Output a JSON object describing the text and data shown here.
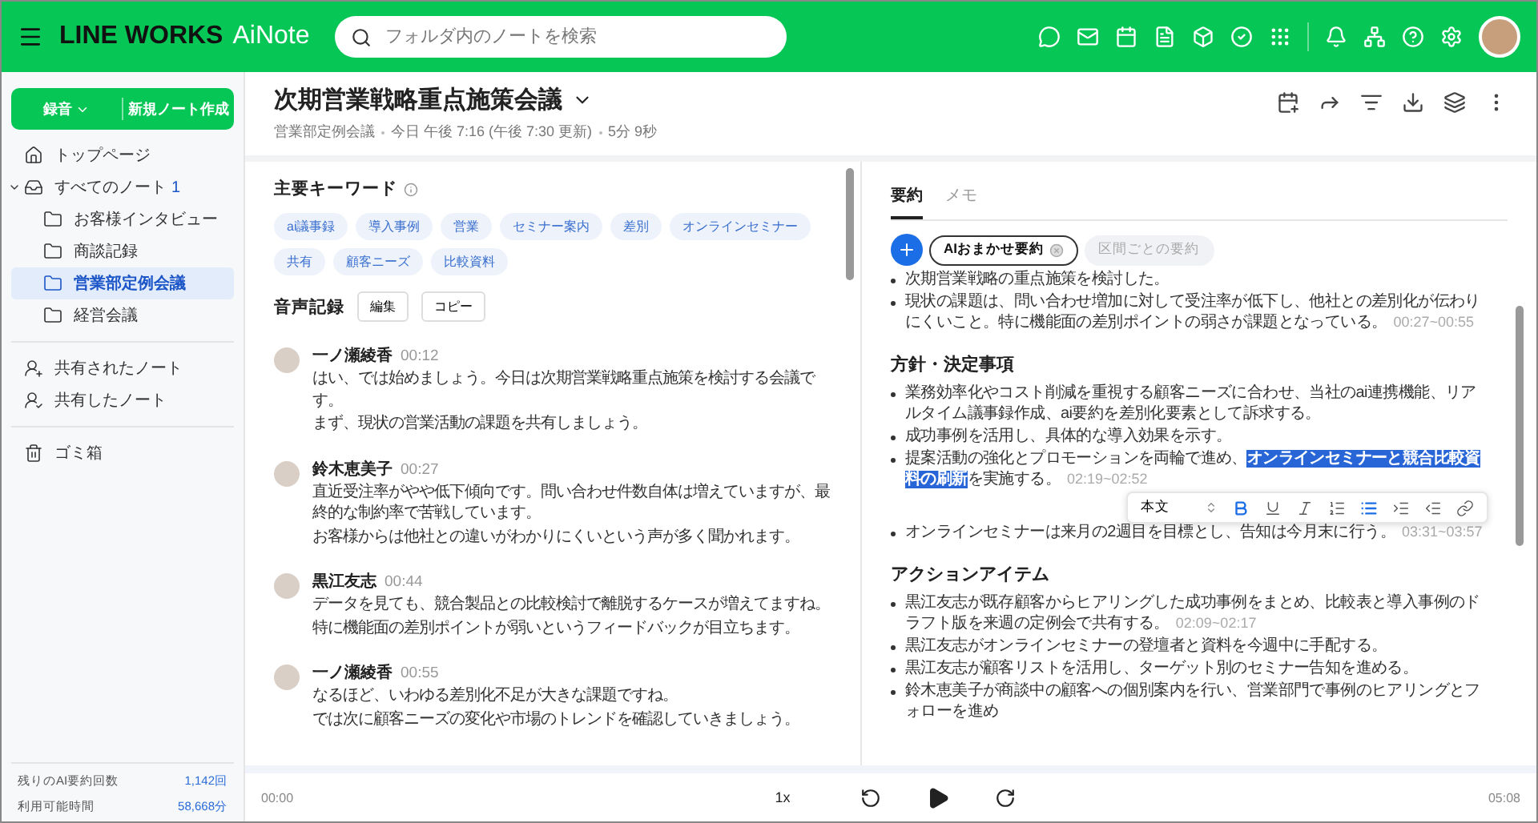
{
  "header": {
    "brand": "LINE WORKS",
    "product": "AiNote",
    "search": {
      "placeholder": "フォルダ内のノートを検索"
    }
  },
  "sidebar": {
    "record_button": "録音",
    "new_note_button": "新規ノート作成",
    "items": [
      {
        "kind": "home",
        "label": "トップページ",
        "selected": false
      },
      {
        "kind": "inbox",
        "label": "すべてのノート",
        "count": "1",
        "selected": false,
        "expanded": true,
        "children": [
          {
            "kind": "folder",
            "label": "お客様インタビュー",
            "selected": false
          },
          {
            "kind": "folder",
            "label": "商談記録",
            "selected": false
          },
          {
            "kind": "folder",
            "label": "営業部定例会議",
            "selected": true
          },
          {
            "kind": "folder",
            "label": "経営会議",
            "selected": false
          }
        ]
      },
      {
        "kind": "shared-with",
        "label": "共有されたノート",
        "selected": false
      },
      {
        "kind": "shared-by",
        "label": "共有したノート",
        "selected": false
      },
      {
        "kind": "trash",
        "label": "ゴミ箱",
        "selected": false
      }
    ],
    "stats": [
      {
        "label": "残りのAI要約回数",
        "value": "1,142回"
      },
      {
        "label": "利用可能時間",
        "value": "58,668分"
      }
    ]
  },
  "note": {
    "title": "次期営業戦略重点施策会議",
    "meta": [
      "営業部定例会議",
      "今日 午後 7:16 (午後 7:30 更新)",
      "5分 9秒"
    ]
  },
  "keywords": {
    "title": "主要キーワード",
    "tags": [
      "ai議事録",
      "導入事例",
      "営業",
      "セミナー案内",
      "差別",
      "オンラインセミナー",
      "共有",
      "顧客ニーズ",
      "比較資料"
    ]
  },
  "transcript": {
    "title": "音声記録",
    "buttons": [
      "編集",
      "コピー"
    ],
    "entries": [
      {
        "speaker": "一ノ瀬綾香",
        "time": "00:12",
        "lines": [
          "はい、では始めましょう。今日は次期営業戦略重点施策を検討する会議です。",
          "まず、現状の営業活動の課題を共有しましょう。"
        ]
      },
      {
        "speaker": "鈴木恵美子",
        "time": "00:27",
        "lines": [
          "直近受注率がやや低下傾向です。問い合わせ件数自体は増えていますが、最終的な制約率で苦戦しています。",
          "お客様からは他社との違いがわかりにくいという声が多く聞かれます。"
        ]
      },
      {
        "speaker": "黒江友志",
        "time": "00:44",
        "lines": [
          "データを見ても、競合製品との比較検討で離脱するケースが増えてますね。",
          "特に機能面の差別ポイントが弱いというフィードバックが目立ちます。"
        ]
      },
      {
        "speaker": "一ノ瀬綾香",
        "time": "00:55",
        "lines": [
          "なるほど、いわゆる差別化不足が大きな課題ですね。",
          "では次に顧客ニーズの変化や市場のトレンドを確認していきましょう。"
        ]
      }
    ]
  },
  "summary": {
    "tabs": [
      {
        "label": "要約",
        "selected": true
      },
      {
        "label": "メモ",
        "selected": false
      }
    ],
    "modes": [
      {
        "label": "AIおまかせ要約",
        "selected": true
      },
      {
        "label": "区間ごとの要約",
        "selected": false
      }
    ],
    "sections": [
      {
        "bullets": [
          {
            "parts": [
              {
                "text": "次期営業戦略の重点施策を検討した。",
                "selected": false
              }
            ]
          },
          {
            "parts": [
              {
                "text": "現状の課題は、問い合わせ増加に対して受注率が低下し、他社との差別化が伝わりにくいこと。特に機能面の差別ポイントの弱さが課題となっている。",
                "selected": false
              }
            ],
            "time": "00:27~00:55"
          }
        ]
      },
      {
        "heading": "方針・決定事項",
        "bullets": [
          {
            "parts": [
              {
                "text": "業務効率化やコスト削減を重視する顧客ニーズに合わせ、当社のai連携機能、リアルタイム議事録作成、ai要約を差別化要素として訴求する。",
                "selected": false
              }
            ]
          },
          {
            "parts": [
              {
                "text": "成功事例を活用し、具体的な導入効果を示す。",
                "selected": false
              }
            ]
          },
          {
            "parts": [
              {
                "text": "提案活動の強化とプロモーションを両輪で進め、",
                "selected": false
              },
              {
                "text": "オンラインセミナーと競合比較資料の刷新",
                "selected": true
              },
              {
                "text": "を実施する。",
                "selected": false
              }
            ],
            "time": "02:19~02:52",
            "toolbar": true
          },
          {
            "parts": [
              {
                "text": "オンラインセミナーは来月の2週目を目標とし、告知は今月末に行う。",
                "selected": false
              }
            ],
            "time": "03:31~03:57"
          }
        ]
      },
      {
        "heading": "アクションアイテム",
        "bullets": [
          {
            "parts": [
              {
                "text": "黒江友志が既存顧客からヒアリングした成功事例をまとめ、比較表と導入事例のドラフト版を来週の定例会で共有する。",
                "selected": false
              }
            ],
            "time": "02:09~02:17"
          },
          {
            "parts": [
              {
                "text": "黒江友志がオンラインセミナーの登壇者と資料を今週中に手配する。",
                "selected": false
              }
            ]
          },
          {
            "parts": [
              {
                "text": "黒江友志が顧客リストを活用し、ターゲット別のセミナー告知を進める。",
                "selected": false
              }
            ]
          },
          {
            "parts": [
              {
                "text": "鈴木恵美子が商談中の顧客への個別案内を行い、営業部門で事例のヒアリングとフォローを進め",
                "selected": false
              }
            ]
          }
        ]
      }
    ],
    "toolbar": {
      "style": "本文",
      "tools": [
        {
          "kind": "bold",
          "active": true
        },
        {
          "kind": "underline",
          "active": false
        },
        {
          "kind": "italic",
          "active": false
        },
        {
          "kind": "ordered",
          "active": false
        },
        {
          "kind": "bullet",
          "active": true
        },
        {
          "kind": "indent",
          "active": false
        },
        {
          "kind": "outdent",
          "active": false
        },
        {
          "kind": "link",
          "active": false
        }
      ]
    }
  },
  "player": {
    "position": "00:00",
    "speed": "1x",
    "duration": "05:08"
  }
}
